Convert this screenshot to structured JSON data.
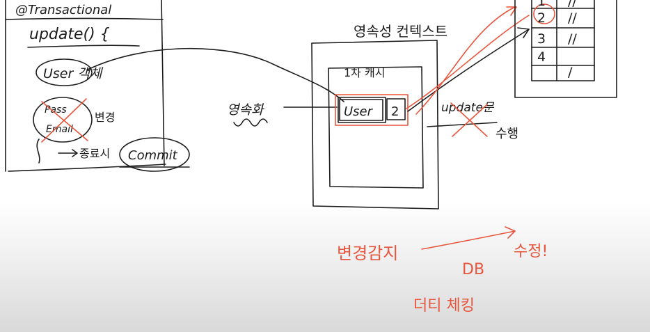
{
  "left_panel": {
    "annotation": "@Transactional",
    "method": "update() {",
    "user_object": "User 객체",
    "pass_field": "Pass",
    "email_field": "Email",
    "change_label": "변경",
    "end_label": "종료시",
    "commit_label": "Commit"
  },
  "persistence_context": {
    "title": "영속성 컨텍스트",
    "first_level_cache": "1차 캐시",
    "entity_label": "User",
    "entity_id": "2",
    "persist_label": "영속화",
    "update_label": "update문",
    "execute_label": "수행"
  },
  "db_table": {
    "rows": [
      {
        "id": "1",
        "value": "//"
      },
      {
        "id": "2",
        "value": "//"
      },
      {
        "id": "3",
        "value": "//"
      },
      {
        "id": "4",
        "value": "/"
      }
    ]
  },
  "bottom_notes": {
    "dirty_checking": "변경감지",
    "db": "DB",
    "flush": "수정!",
    "dirty_checking_term": "더티 체킹"
  },
  "colors": {
    "ink": "#1c1c1c",
    "marker_red": "#e8553d",
    "background": "#ffffff"
  }
}
